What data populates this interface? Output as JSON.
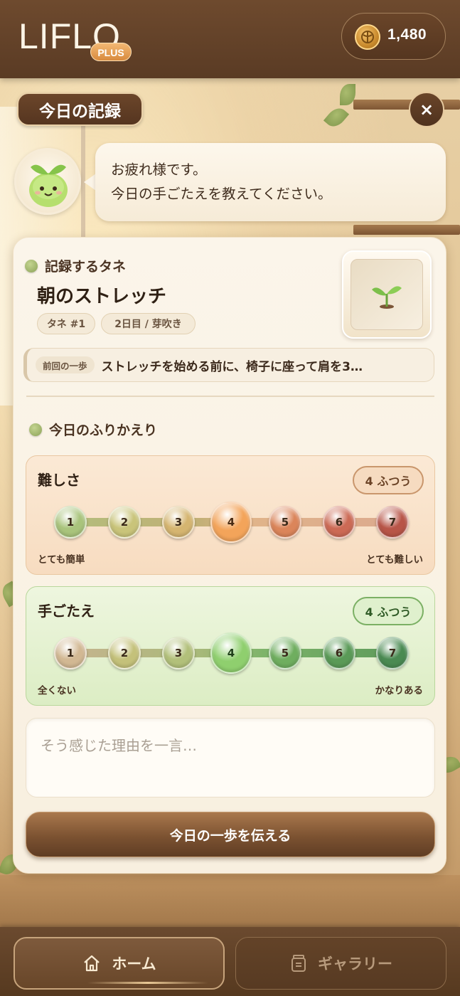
{
  "header": {
    "logo_text": "LIFLO",
    "plus_label": "PLUS",
    "coins": "1,480",
    "coin_icon": "coin-icon"
  },
  "page": {
    "title": "今日の記録",
    "close_label": "×"
  },
  "mascot": {
    "icon": "sprout-mascot-icon",
    "message_line1": "お疲れ様です。",
    "message_line2": "今日の手ごたえを教えてください。"
  },
  "seed": {
    "section_label": "記録するタネ",
    "name": "朝のストレッチ",
    "tags": [
      "タネ #1",
      "2日目 / 芽吹き"
    ],
    "thumbnail_icon": "sprout-icon"
  },
  "previous_step": {
    "label": "前回の一歩",
    "text": "ストレッチを始める前に、椅子に座って肩を3…"
  },
  "reflection": {
    "section_label": "今日のふりかえり",
    "difficulty": {
      "title": "難しさ",
      "badge": "4 ふつう",
      "selected": 4,
      "steps": [
        "1",
        "2",
        "3",
        "4",
        "5",
        "6",
        "7"
      ],
      "colors": [
        "#a9c47c",
        "#c9c47a",
        "#d5b570",
        "#f3a45a",
        "#db855a",
        "#cc6a55",
        "#b85548"
      ],
      "min_label": "とても簡単",
      "max_label": "とても難しい"
    },
    "feel": {
      "title": "手ごたえ",
      "badge": "4 ふつう",
      "selected": 4,
      "steps": [
        "1",
        "2",
        "3",
        "4",
        "5",
        "6",
        "7"
      ],
      "colors": [
        "#d2b893",
        "#c4c17a",
        "#b2c07a",
        "#8fcf6e",
        "#6fae5f",
        "#5a9a57",
        "#4a8a52"
      ],
      "min_label": "全くない",
      "max_label": "かなりある"
    },
    "reason_placeholder": "そう感じた理由を一言…"
  },
  "submit_label": "今日の一歩を伝える",
  "nav": {
    "home_label": "ホーム",
    "home_icon": "home-icon",
    "gallery_label": "ギャラリー",
    "gallery_icon": "gallery-jar-icon"
  }
}
